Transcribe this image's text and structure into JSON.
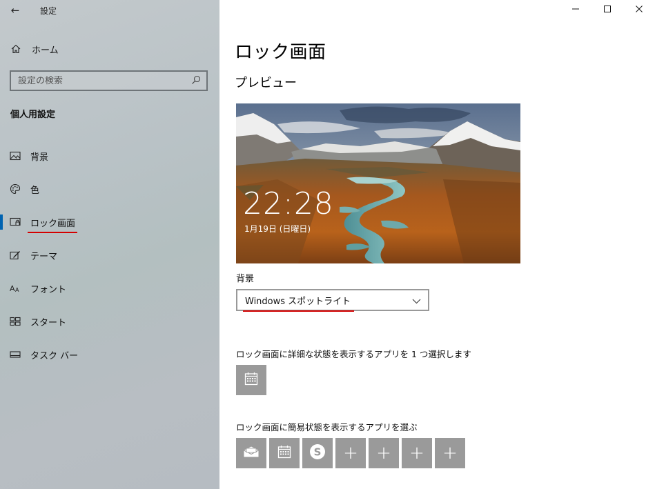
{
  "window": {
    "title": "設定",
    "controls": {
      "minimize": "—",
      "maximize": "☐",
      "close": "✕"
    }
  },
  "sidebar": {
    "back_glyph": "←",
    "home": {
      "label": "ホーム",
      "icon": "home-icon"
    },
    "search": {
      "placeholder": "設定の検索",
      "icon": "search-icon"
    },
    "section_title": "個人用設定",
    "items": [
      {
        "label": "背景",
        "icon": "picture-icon",
        "active": false
      },
      {
        "label": "色",
        "icon": "palette-icon",
        "active": false
      },
      {
        "label": "ロック画面",
        "icon": "lock-screen-icon",
        "active": true
      },
      {
        "label": "テーマ",
        "icon": "theme-icon",
        "active": false
      },
      {
        "label": "フォント",
        "icon": "font-icon",
        "active": false
      },
      {
        "label": "スタート",
        "icon": "start-icon",
        "active": false
      },
      {
        "label": "タスク バー",
        "icon": "taskbar-icon",
        "active": false
      }
    ]
  },
  "main": {
    "title": "ロック画面",
    "preview_heading": "プレビュー",
    "preview": {
      "time": "22:28",
      "date": "1月19日 (日曜日)"
    },
    "background_label": "背景",
    "background_value": "Windows スポットライト",
    "detailed_status_label": "ロック画面に詳細な状態を表示するアプリを 1 つ選択します",
    "detailed_status_app": {
      "icon": "calendar-icon"
    },
    "quick_status_label": "ロック画面に簡易状態を表示するアプリを選ぶ",
    "quick_status_apps": [
      {
        "icon": "mail-icon"
      },
      {
        "icon": "calendar-icon"
      },
      {
        "icon": "skype-icon"
      },
      {
        "icon": "plus-icon",
        "text": "+"
      },
      {
        "icon": "plus-icon",
        "text": "+"
      },
      {
        "icon": "plus-icon",
        "text": "+"
      },
      {
        "icon": "plus-icon",
        "text": "+"
      }
    ]
  },
  "colors": {
    "accent": "#0063b1",
    "annotation_underline": "#d40000",
    "tile_gray": "#9a9a9a"
  }
}
